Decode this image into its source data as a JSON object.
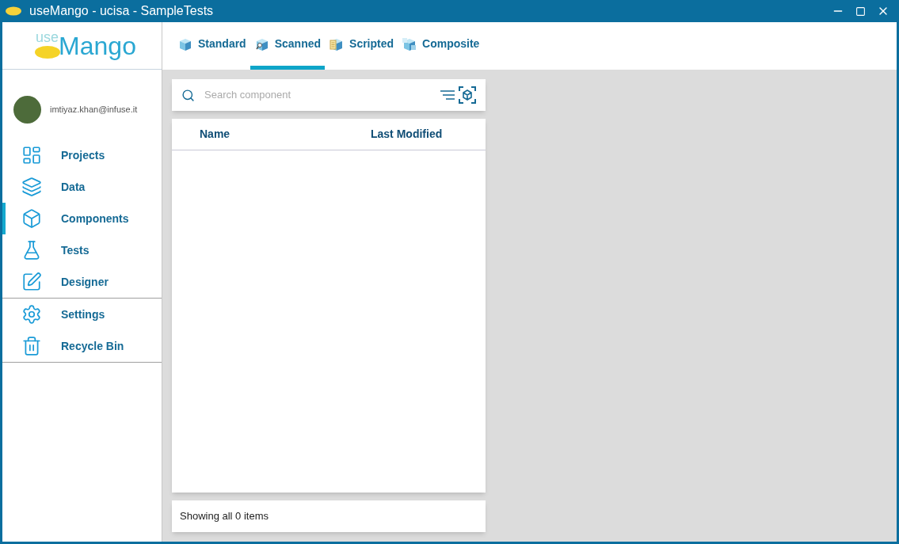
{
  "window": {
    "title": "useMango - ucisa - SampleTests"
  },
  "logo": {
    "prefix": "use",
    "name": "Mango"
  },
  "user": {
    "email": "imtiyaz.khan@infuse.it"
  },
  "nav_sections": [
    [
      {
        "label": "Projects",
        "kind": "projects",
        "selected": false
      },
      {
        "label": "Data",
        "kind": "data",
        "selected": false
      },
      {
        "label": "Components",
        "kind": "components",
        "selected": true
      },
      {
        "label": "Tests",
        "kind": "tests",
        "selected": false
      },
      {
        "label": "Designer",
        "kind": "designer",
        "selected": false
      }
    ],
    [
      {
        "label": "Settings",
        "kind": "settings",
        "selected": false
      },
      {
        "label": "Recycle Bin",
        "kind": "recycle",
        "selected": false
      }
    ]
  ],
  "tabs": [
    {
      "label": "Standard",
      "kind": "standard",
      "selected": false
    },
    {
      "label": "Scanned",
      "kind": "scanned",
      "selected": true
    },
    {
      "label": "Scripted",
      "kind": "scripted",
      "selected": false
    },
    {
      "label": "Composite",
      "kind": "composite",
      "selected": false
    }
  ],
  "search": {
    "placeholder": "Search component"
  },
  "table": {
    "columns": [
      "Name",
      "Last Modified"
    ]
  },
  "status": "Showing all 0 items"
}
